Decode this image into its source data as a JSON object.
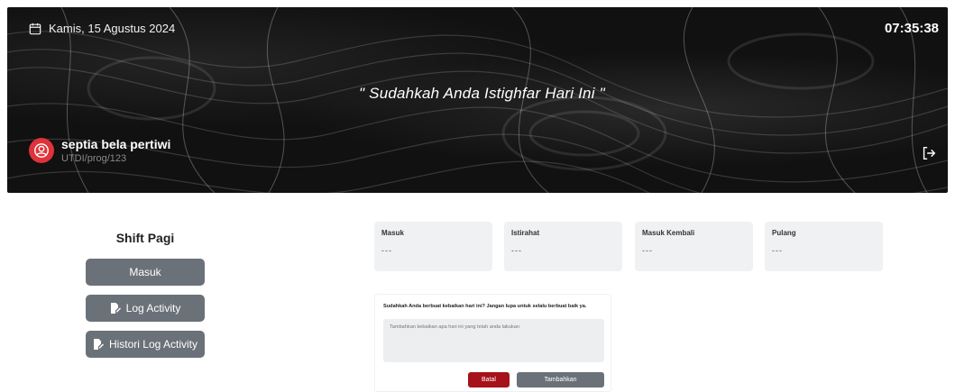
{
  "header": {
    "date": "Kamis, 15 Agustus 2024",
    "time": "07:35:38",
    "quote": "\" Sudahkah Anda Istighfar Hari Ini \"",
    "user": {
      "name": "septia bela pertiwi",
      "id": "UTDI/prog/123"
    },
    "icons": {
      "date": "calendar-icon",
      "avatar": "user-circle-icon",
      "logout": "logout-icon"
    }
  },
  "shift": {
    "title": "Shift Pagi",
    "buttons": [
      {
        "label": "Masuk",
        "icon": ""
      },
      {
        "label": "Log Activity",
        "icon": "file-edit-icon"
      },
      {
        "label": "Histori Log Activity",
        "icon": "file-edit-icon"
      }
    ]
  },
  "attendance": [
    {
      "label": "Masuk",
      "value": "---"
    },
    {
      "label": "Istirahat",
      "value": "---"
    },
    {
      "label": "Masuk Kembali",
      "value": "---"
    },
    {
      "label": "Pulang",
      "value": "---"
    }
  ],
  "kindness": {
    "prompt": "Sudahkah Anda berbuat kebaikan hari ini? Jangan lupa untuk selalu berbuat baik ya.",
    "placeholder": "Tambahkan kebaikan apa hari ini yang telah anda lakukan",
    "cancel_label": "Batal",
    "submit_label": "Tambahkan"
  },
  "colors": {
    "primary_button": "#6b7178",
    "danger": "#a5121a",
    "avatar": "#e0323b",
    "card_bg": "#f0f1f3"
  }
}
